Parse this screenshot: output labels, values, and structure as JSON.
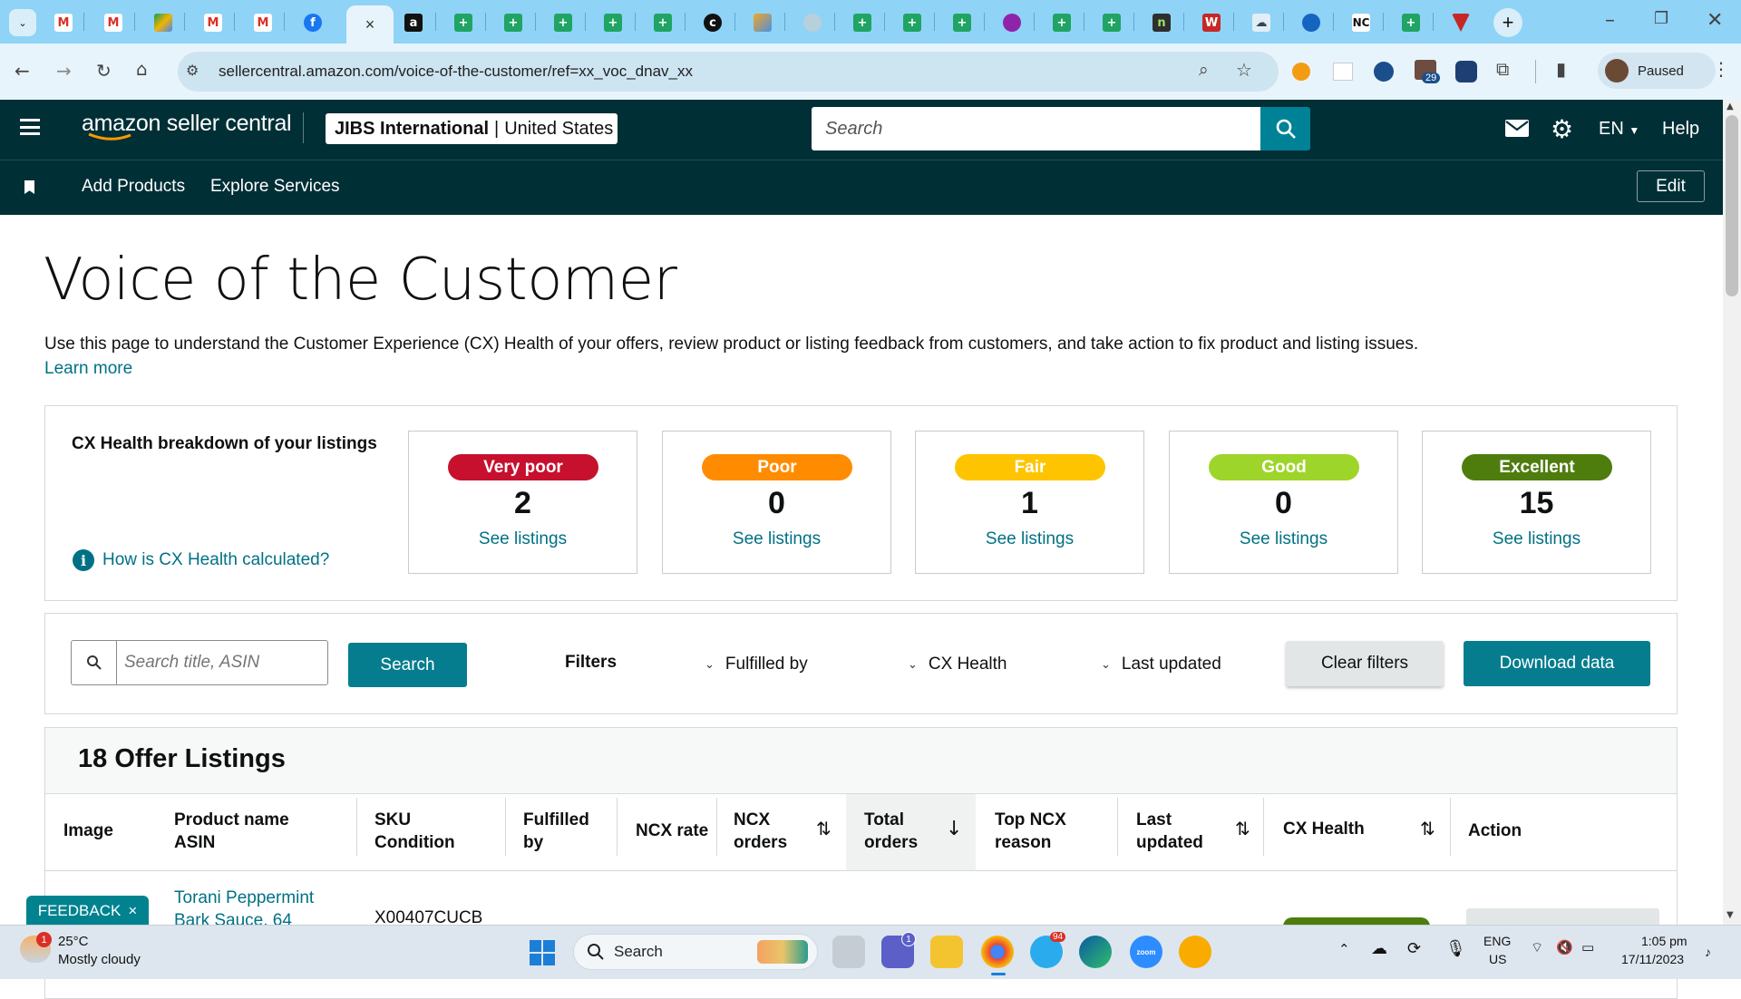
{
  "browser": {
    "url": "sellercentral.amazon.com/voice-of-the-customer/ref=xx_voc_dnav_xx",
    "profile_status": "Paused",
    "extension_badge": "29",
    "tab_close": "×"
  },
  "header": {
    "logo": "amazon seller central",
    "account_name": "JIBS International",
    "account_region": "United States",
    "search_placeholder": "Search",
    "language": "EN",
    "help": "Help",
    "nav_items": [
      "Add Products",
      "Explore Services"
    ],
    "edit": "Edit"
  },
  "page": {
    "title": "Voice of the Customer",
    "intro": "Use this page to understand the Customer Experience (CX) Health of your offers, review product or listing feedback from customers, and take action to fix product and listing issues.",
    "learn_more": "Learn more"
  },
  "breakdown": {
    "label": "CX Health breakdown of your listings",
    "how_link": "How is CX Health calculated?",
    "cards": [
      {
        "label": "Very poor",
        "count": "2",
        "link": "See listings",
        "color": "#c7102e"
      },
      {
        "label": "Poor",
        "count": "0",
        "link": "See listings",
        "color": "#ff8c00"
      },
      {
        "label": "Fair",
        "count": "1",
        "link": "See listings",
        "color": "#ffc400"
      },
      {
        "label": "Good",
        "count": "0",
        "link": "See listings",
        "color": "#9ed52a"
      },
      {
        "label": "Excellent",
        "count": "15",
        "link": "See listings",
        "color": "#4e7d0e"
      }
    ]
  },
  "filters": {
    "search_placeholder": "Search title, ASIN",
    "search_button": "Search",
    "filters_label": "Filters",
    "fulfilled_by": "Fulfilled by",
    "cx_health": "CX Health",
    "last_updated": "Last updated",
    "clear": "Clear filters",
    "download": "Download data"
  },
  "listings": {
    "title": "18 Offer Listings",
    "columns": {
      "image": "Image",
      "product_1": "Product name",
      "product_2": "ASIN",
      "sku_1": "SKU",
      "sku_2": "Condition",
      "fulfilled_1": "Fulfilled",
      "fulfilled_2": "by",
      "ncx_rate": "NCX rate",
      "ncx_orders_1": "NCX",
      "ncx_orders_2": "orders",
      "total_1": "Total",
      "total_2": "orders",
      "top_1": "Top NCX",
      "top_2": "reason",
      "last_1": "Last",
      "last_2": "updated",
      "cx_health": "CX Health",
      "action": "Action"
    },
    "rows": [
      {
        "name_1": "Torani Peppermint",
        "name_2": "Bark Sauce, 64",
        "sku": "X00407CUCB"
      }
    ]
  },
  "feedback": "FEEDBACK",
  "taskbar": {
    "weather_temp": "25°C",
    "weather_desc": "Mostly cloudy",
    "weather_badge": "1",
    "search": "Search",
    "lang_1": "ENG",
    "lang_2": "US",
    "time": "1:05 pm",
    "date": "17/11/2023",
    "teams_badge": "1",
    "telegram_badge": "94"
  }
}
